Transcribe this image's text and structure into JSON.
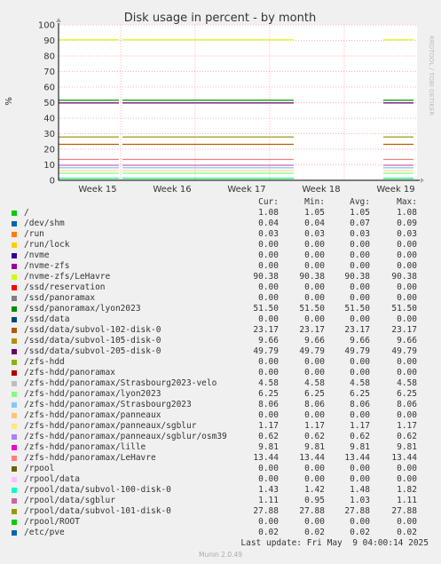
{
  "chart_data": {
    "type": "line",
    "title": "Disk usage in percent - by month",
    "ylabel": "%",
    "side_label": "RRDTOOL / TOBI OETIKER",
    "ylim": [
      0,
      100
    ],
    "yticks": [
      0,
      10,
      20,
      30,
      40,
      50,
      60,
      70,
      80,
      90,
      100
    ],
    "xticks": [
      "Week 15",
      "Week 16",
      "Week 17",
      "Week 18",
      "Week 19"
    ],
    "grid": true,
    "series": [
      {
        "name": "/",
        "color": "#00cc00",
        "value": 1.08
      },
      {
        "name": "/nvme-zfs/LeHavre",
        "color": "#ccff00",
        "value": 90.38
      },
      {
        "name": "/ssd/panoramax/lyon2023",
        "color": "#008f00",
        "value": 51.5
      },
      {
        "name": "/ssd/data/subvol-102-disk-0",
        "color": "#b35a00",
        "value": 23.17
      },
      {
        "name": "/ssd/data/subvol-105-disk-0",
        "color": "#b38f00",
        "value": 9.66
      },
      {
        "name": "/ssd/data/subvol-205-disk-0",
        "color": "#6b006b",
        "value": 49.79
      },
      {
        "name": "/zfs-hdd/panoramax/Strasbourg2023-velo",
        "color": "#80ff80",
        "value": 4.58
      },
      {
        "name": "/zfs-hdd/panoramax/lyon2023",
        "color": "#ffd280",
        "value": 6.25
      },
      {
        "name": "/zfs-hdd/panoramax/Strasbourg2023",
        "color": "#80bfff",
        "value": 8.06
      },
      {
        "name": "/zfs-hdd/panoramax/panneaux/sgblur",
        "color": "#ffe680",
        "value": 1.17
      },
      {
        "name": "/zfs-hdd/panoramax/lille",
        "color": "#e680ff",
        "value": 9.81
      },
      {
        "name": "/zfs-hdd/panoramax/LeHavre",
        "color": "#f08080",
        "value": 13.44
      },
      {
        "name": "/rpool/data/subvol-100-disk-0",
        "color": "#33ffbf",
        "value": 1.43
      },
      {
        "name": "/rpool/data/subvol-101-disk-0",
        "color": "#8f8f00",
        "value": 27.88
      }
    ]
  },
  "legend": {
    "headers": {
      "cur": "Cur:",
      "min": "Min:",
      "avg": "Avg:",
      "max": "Max:"
    },
    "rows": [
      {
        "name": "/",
        "color": "#00cc00",
        "cur": "1.08",
        "min": "1.05",
        "avg": "1.05",
        "max": "1.08"
      },
      {
        "name": "/dev/shm",
        "color": "#0066b3",
        "cur": "0.04",
        "min": "0.04",
        "avg": "0.07",
        "max": "0.09"
      },
      {
        "name": "/run",
        "color": "#ff8000",
        "cur": "0.03",
        "min": "0.03",
        "avg": "0.03",
        "max": "0.03"
      },
      {
        "name": "/run/lock",
        "color": "#ffcc00",
        "cur": "0.00",
        "min": "0.00",
        "avg": "0.00",
        "max": "0.00"
      },
      {
        "name": "/nvme",
        "color": "#330099",
        "cur": "0.00",
        "min": "0.00",
        "avg": "0.00",
        "max": "0.00"
      },
      {
        "name": "/nvme-zfs",
        "color": "#990099",
        "cur": "0.00",
        "min": "0.00",
        "avg": "0.00",
        "max": "0.00"
      },
      {
        "name": "/nvme-zfs/LeHavre",
        "color": "#ccff00",
        "cur": "90.38",
        "min": "90.38",
        "avg": "90.38",
        "max": "90.38"
      },
      {
        "name": "/ssd/reservation",
        "color": "#ff0000",
        "cur": "0.00",
        "min": "0.00",
        "avg": "0.00",
        "max": "0.00"
      },
      {
        "name": "/ssd/panoramax",
        "color": "#808080",
        "cur": "0.00",
        "min": "0.00",
        "avg": "0.00",
        "max": "0.00"
      },
      {
        "name": "/ssd/panoramax/lyon2023",
        "color": "#008f00",
        "cur": "51.50",
        "min": "51.50",
        "avg": "51.50",
        "max": "51.50"
      },
      {
        "name": "/ssd/data",
        "color": "#00487d",
        "cur": "0.00",
        "min": "0.00",
        "avg": "0.00",
        "max": "0.00"
      },
      {
        "name": "/ssd/data/subvol-102-disk-0",
        "color": "#b35a00",
        "cur": "23.17",
        "min": "23.17",
        "avg": "23.17",
        "max": "23.17"
      },
      {
        "name": "/ssd/data/subvol-105-disk-0",
        "color": "#b38f00",
        "cur": "9.66",
        "min": "9.66",
        "avg": "9.66",
        "max": "9.66"
      },
      {
        "name": "/ssd/data/subvol-205-disk-0",
        "color": "#6b006b",
        "cur": "49.79",
        "min": "49.79",
        "avg": "49.79",
        "max": "49.79"
      },
      {
        "name": "/zfs-hdd",
        "color": "#8fb300",
        "cur": "0.00",
        "min": "0.00",
        "avg": "0.00",
        "max": "0.00"
      },
      {
        "name": "/zfs-hdd/panoramax",
        "color": "#b30000",
        "cur": "0.00",
        "min": "0.00",
        "avg": "0.00",
        "max": "0.00"
      },
      {
        "name": "/zfs-hdd/panoramax/Strasbourg2023-velo",
        "color": "#bebebe",
        "cur": "4.58",
        "min": "4.58",
        "avg": "4.58",
        "max": "4.58"
      },
      {
        "name": "/zfs-hdd/panoramax/lyon2023",
        "color": "#80ff80",
        "cur": "6.25",
        "min": "6.25",
        "avg": "6.25",
        "max": "6.25"
      },
      {
        "name": "/zfs-hdd/panoramax/Strasbourg2023",
        "color": "#80c9ff",
        "cur": "8.06",
        "min": "8.06",
        "avg": "8.06",
        "max": "8.06"
      },
      {
        "name": "/zfs-hdd/panoramax/panneaux",
        "color": "#ffc080",
        "cur": "0.00",
        "min": "0.00",
        "avg": "0.00",
        "max": "0.00"
      },
      {
        "name": "/zfs-hdd/panoramax/panneaux/sgblur",
        "color": "#ffe680",
        "cur": "1.17",
        "min": "1.17",
        "avg": "1.17",
        "max": "1.17"
      },
      {
        "name": "/zfs-hdd/panoramax/panneaux/sgblur/osm39",
        "color": "#aa80ff",
        "cur": "0.62",
        "min": "0.62",
        "avg": "0.62",
        "max": "0.62"
      },
      {
        "name": "/zfs-hdd/panoramax/lille",
        "color": "#ee00cc",
        "cur": "9.81",
        "min": "9.81",
        "avg": "9.81",
        "max": "9.81"
      },
      {
        "name": "/zfs-hdd/panoramax/LeHavre",
        "color": "#ff8080",
        "cur": "13.44",
        "min": "13.44",
        "avg": "13.44",
        "max": "13.44"
      },
      {
        "name": "/rpool",
        "color": "#666600",
        "cur": "0.00",
        "min": "0.00",
        "avg": "0.00",
        "max": "0.00"
      },
      {
        "name": "/rpool/data",
        "color": "#ffbfff",
        "cur": "0.00",
        "min": "0.00",
        "avg": "0.00",
        "max": "0.00"
      },
      {
        "name": "/rpool/data/subvol-100-disk-0",
        "color": "#00ffcc",
        "cur": "1.43",
        "min": "1.42",
        "avg": "1.48",
        "max": "1.82"
      },
      {
        "name": "/rpool/data/sgblur",
        "color": "#cc6699",
        "cur": "1.11",
        "min": "0.95",
        "avg": "1.03",
        "max": "1.11"
      },
      {
        "name": "/rpool/data/subvol-101-disk-0",
        "color": "#999900",
        "cur": "27.88",
        "min": "27.88",
        "avg": "27.88",
        "max": "27.88"
      },
      {
        "name": "/rpool/ROOT",
        "color": "#00cc00",
        "cur": "0.00",
        "min": "0.00",
        "avg": "0.00",
        "max": "0.00"
      },
      {
        "name": "/etc/pve",
        "color": "#0066b3",
        "cur": "0.02",
        "min": "0.02",
        "avg": "0.02",
        "max": "0.02"
      }
    ]
  },
  "footer": {
    "last_update": "Last update: Fri May  9 04:00:14 2025",
    "munin": "Munin 2.0.49"
  }
}
